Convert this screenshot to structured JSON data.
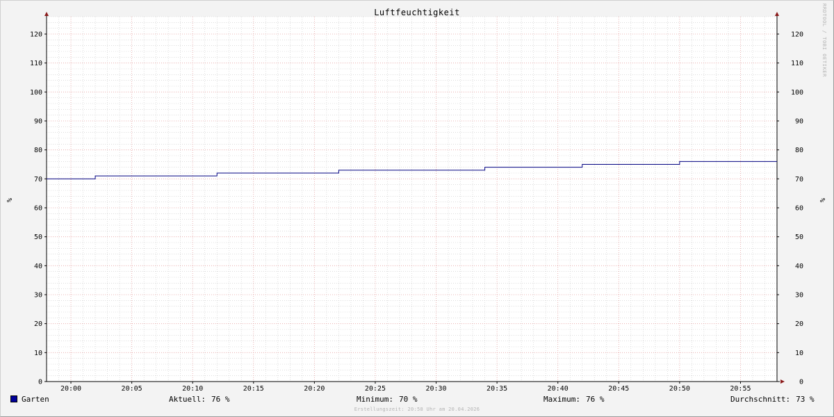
{
  "chart_data": {
    "type": "line",
    "title": "Luftfeuchtigkeit",
    "ylabel": "%",
    "ylim": [
      0,
      126
    ],
    "y_ticks": [
      0,
      10,
      20,
      30,
      40,
      50,
      60,
      70,
      80,
      90,
      100,
      110,
      120
    ],
    "xlim": [
      "19:58",
      "20:58"
    ],
    "x_ticks": [
      "20:00",
      "20:05",
      "20:10",
      "20:15",
      "20:20",
      "20:25",
      "20:30",
      "20:35",
      "20:40",
      "20:45",
      "20:50",
      "20:55"
    ],
    "grid": true,
    "series": [
      {
        "name": "Garten",
        "color": "#000080",
        "step": true,
        "x": [
          "19:58",
          "20:02",
          "20:12",
          "20:22",
          "20:34",
          "20:42",
          "20:50"
        ],
        "y": [
          70,
          71,
          72,
          73,
          74,
          75,
          76
        ]
      }
    ]
  },
  "watermark": "RRDTOOL / TOBI OETIKER",
  "legend": {
    "series_name": "Garten",
    "swatch_color": "#000099",
    "current_label": "Aktuell:",
    "current_value": "76 %",
    "min_label": "Minimum:",
    "min_value": "70 %",
    "max_label": "Maximum:",
    "max_value": "76 %",
    "avg_label": "Durchschnitt:",
    "avg_value": "73 %"
  },
  "footer": "Erstellungszeit: 20:58 Uhr am 20.04.2026",
  "colors": {
    "plot_background": "#ffffff",
    "minor_grid": "#c8c8c8",
    "major_grid": "#e5a0a0",
    "axis": "#000000",
    "arrow": "#8b1a1a"
  }
}
